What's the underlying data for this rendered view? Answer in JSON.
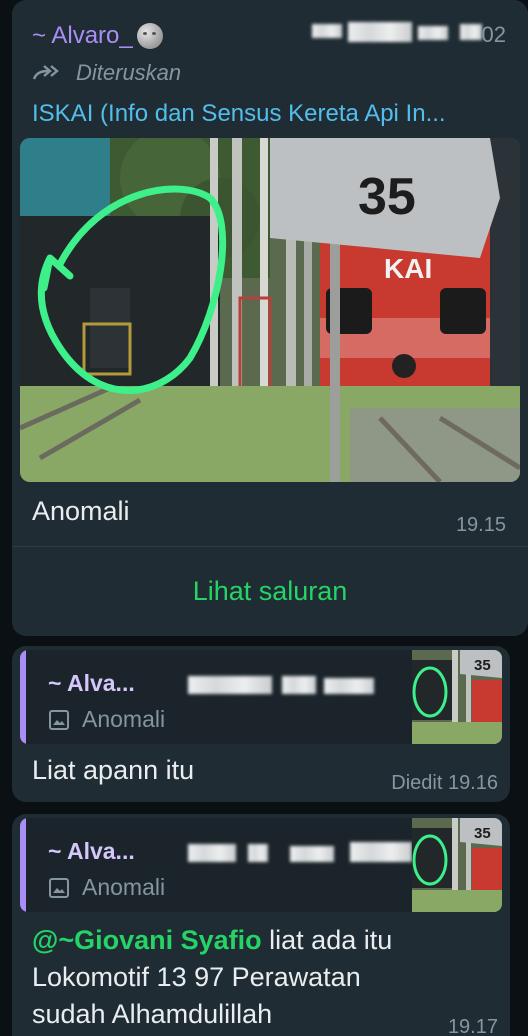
{
  "message1": {
    "sender": "~ Alvaro_",
    "sender_emoji": "moon-face",
    "phone_tail": "02",
    "forwarded_label": "Diteruskan",
    "channel_name": "ISKAI (Info dan Sensus Kereta Api In...",
    "photo_text": {
      "sign_number": "35",
      "locomotive_logo": "KAI"
    },
    "caption": "Anomali",
    "time": "19.15",
    "action_button": "Lihat saluran"
  },
  "message2": {
    "quote": {
      "sender": "~ Alva...",
      "label": "Anomali",
      "thumb_sign": "35"
    },
    "text": "Liat apann itu",
    "time": "Diedit 19.16"
  },
  "message3": {
    "quote": {
      "sender": "~ Alva...",
      "label": "Anomali",
      "thumb_sign": "35"
    },
    "mention": "@~Giovani Syafio",
    "text_after_mention": " liat ada itu",
    "line2": "Lokomotif 13 97 Perawatan",
    "line3": "sudah Alhamdulillah",
    "time": "19.17"
  },
  "colors": {
    "background": "#0b1014",
    "bubble": "#1f2c33",
    "sender": "#a98ef6",
    "channel_link": "#53bdeb",
    "accent_green": "#25d366",
    "muted": "#8696a0"
  }
}
